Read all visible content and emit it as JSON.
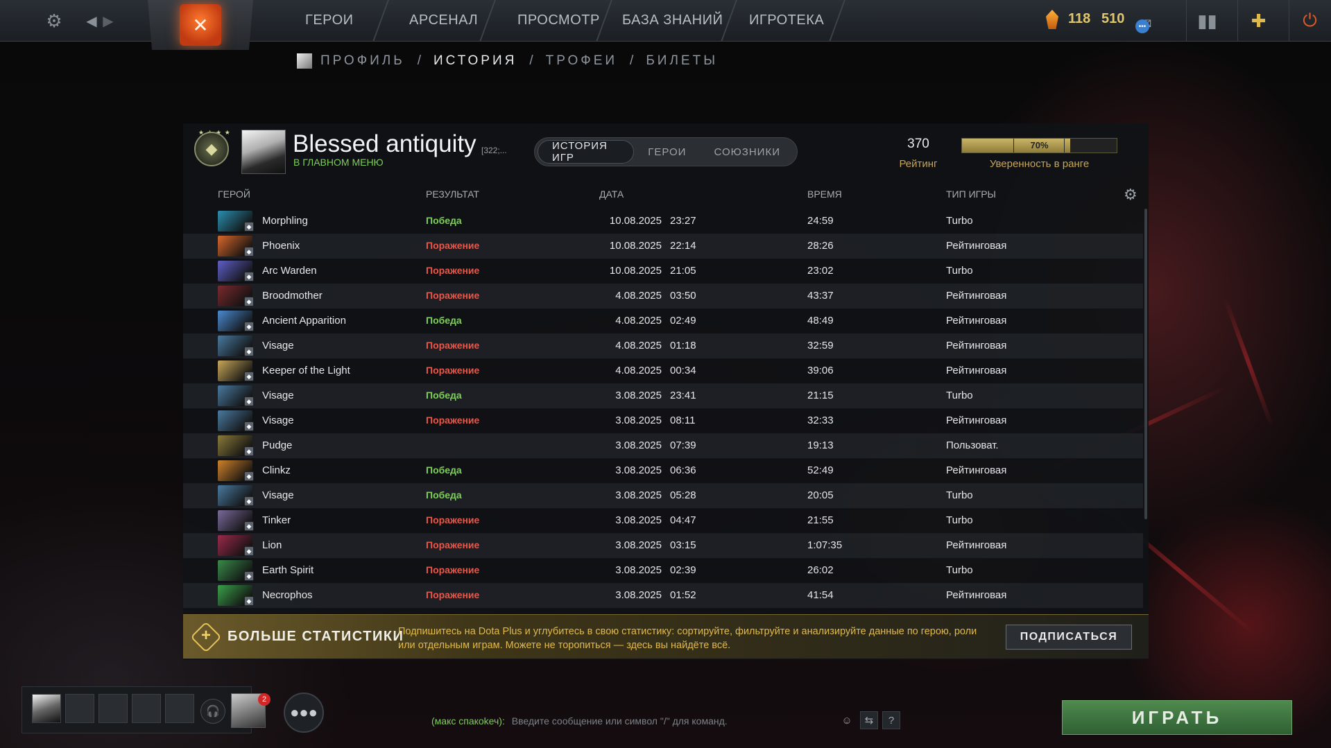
{
  "topbar": {
    "nav": [
      "ГЕРОИ",
      "АРСЕНАЛ",
      "ПРОСМОТР",
      "БАЗА ЗНАНИЙ",
      "ИГРОТЕКА"
    ],
    "shards": "118",
    "currency2": "510"
  },
  "subnav": [
    "ПРОФИЛЬ",
    "ИСТОРИЯ",
    "ТРОФЕИ",
    "БИЛЕТЫ"
  ],
  "profile": {
    "name": "Blessed antiquity",
    "tag": "[322;...",
    "status": "В ГЛАВНОМ МЕНЮ"
  },
  "tabs": [
    "ИСТОРИЯ ИГР",
    "ГЕРОИ",
    "СОЮЗНИКИ"
  ],
  "rating": {
    "value": "370",
    "label": "Рейтинг"
  },
  "confidence": {
    "percent": "70%",
    "fraction": 0.7,
    "label": "Уверенность в ранге"
  },
  "columns": {
    "hero": "ГЕРОЙ",
    "result": "РЕЗУЛЬТАТ",
    "date": "ДАТА",
    "duration": "ВРЕМЯ",
    "type": "ТИП ИГРЫ"
  },
  "matches": [
    {
      "hero": "Morphling",
      "result": "Победа",
      "date": "10.08.2025",
      "time": "23:27",
      "duration": "24:59",
      "type": "Turbo",
      "color": "#2a8fb0"
    },
    {
      "hero": "Phoenix",
      "result": "Поражение",
      "date": "10.08.2025",
      "time": "22:14",
      "duration": "28:26",
      "type": "Рейтинговая",
      "color": "#d8672a"
    },
    {
      "hero": "Arc Warden",
      "result": "Поражение",
      "date": "10.08.2025",
      "time": "21:05",
      "duration": "23:02",
      "type": "Turbo",
      "color": "#5f5fc8"
    },
    {
      "hero": "Broodmother",
      "result": "Поражение",
      "date": "4.08.2025",
      "time": "03:50",
      "duration": "43:37",
      "type": "Рейтинговая",
      "color": "#7a2a2e"
    },
    {
      "hero": "Ancient Apparition",
      "result": "Победа",
      "date": "4.08.2025",
      "time": "02:49",
      "duration": "48:49",
      "type": "Рейтинговая",
      "color": "#4a8ad0"
    },
    {
      "hero": "Visage",
      "result": "Поражение",
      "date": "4.08.2025",
      "time": "01:18",
      "duration": "32:59",
      "type": "Рейтинговая",
      "color": "#4a7aa0"
    },
    {
      "hero": "Keeper of the Light",
      "result": "Поражение",
      "date": "4.08.2025",
      "time": "00:34",
      "duration": "39:06",
      "type": "Рейтинговая",
      "color": "#c8a75a"
    },
    {
      "hero": "Visage",
      "result": "Победа",
      "date": "3.08.2025",
      "time": "23:41",
      "duration": "21:15",
      "type": "Turbo",
      "color": "#4a7aa0"
    },
    {
      "hero": "Visage",
      "result": "Поражение",
      "date": "3.08.2025",
      "time": "08:11",
      "duration": "32:33",
      "type": "Рейтинговая",
      "color": "#4a7aa0"
    },
    {
      "hero": "Pudge",
      "result": "",
      "date": "3.08.2025",
      "time": "07:39",
      "duration": "19:13",
      "type": "Пользоват.",
      "color": "#8a7a3a"
    },
    {
      "hero": "Clinkz",
      "result": "Победа",
      "date": "3.08.2025",
      "time": "06:36",
      "duration": "52:49",
      "type": "Рейтинговая",
      "color": "#d0822a"
    },
    {
      "hero": "Visage",
      "result": "Победа",
      "date": "3.08.2025",
      "time": "05:28",
      "duration": "20:05",
      "type": "Turbo",
      "color": "#4a7aa0"
    },
    {
      "hero": "Tinker",
      "result": "Поражение",
      "date": "3.08.2025",
      "time": "04:47",
      "duration": "21:55",
      "type": "Turbo",
      "color": "#7a6a9a"
    },
    {
      "hero": "Lion",
      "result": "Поражение",
      "date": "3.08.2025",
      "time": "03:15",
      "duration": "1:07:35",
      "type": "Рейтинговая",
      "color": "#9a2a4a"
    },
    {
      "hero": "Earth Spirit",
      "result": "Поражение",
      "date": "3.08.2025",
      "time": "02:39",
      "duration": "26:02",
      "type": "Turbo",
      "color": "#3a8a4a"
    },
    {
      "hero": "Necrophos",
      "result": "Поражение",
      "date": "3.08.2025",
      "time": "01:52",
      "duration": "41:54",
      "type": "Рейтинговая",
      "color": "#3aa04a"
    }
  ],
  "promo": {
    "title": "БОЛЬШЕ СТАТИСТИКИ",
    "text": "Подпишитесь на Dota Plus и углубитесь в свою статистику: сортируйте, фильтруйте и анализируйте данные по герою, роли или отдельным играм. Можете не торопиться — здесь вы найдёте всё.",
    "button": "ПОДПИСАТЬСЯ"
  },
  "party": {
    "notification_count": "2"
  },
  "chat": {
    "channel": "(макс спакоkеч):",
    "placeholder": "Введите сообщение или символ \"/\" для команд."
  },
  "play_button": "ИГРАТЬ",
  "colors": {
    "win": "#7fcf5a",
    "loss": "#e8584a",
    "gold": "#c7a659"
  }
}
